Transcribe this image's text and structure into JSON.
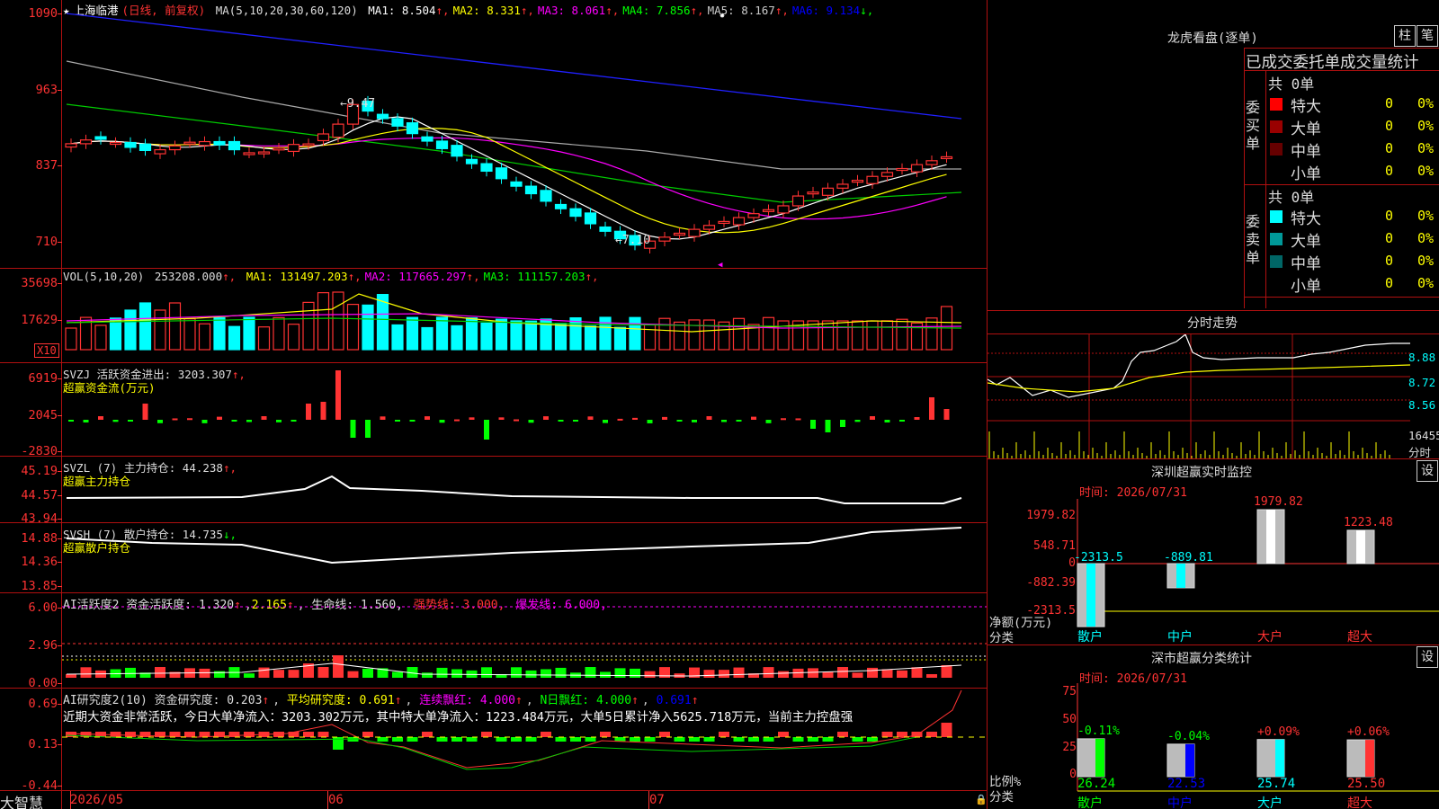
{
  "colors": {
    "up": "#ff3333",
    "down": "#00ffff",
    "green": "#00ff00",
    "grid": "#b01010"
  },
  "price": {
    "stock_name": "上海临港",
    "period_label": "(日线, 前复权)",
    "ma_params": "MA(5,10,20,30,60,120)",
    "ma": [
      {
        "label": "MA1:",
        "value": "8.504",
        "arrow": "↑",
        "color": "#ffffff"
      },
      {
        "label": "MA2:",
        "value": "8.331",
        "arrow": "↑",
        "color": "#ffff00"
      },
      {
        "label": "MA3:",
        "value": "8.061",
        "arrow": "↑",
        "color": "#ff00ff"
      },
      {
        "label": "MA4:",
        "value": "7.856",
        "arrow": "↑",
        "color": "#00ff00"
      },
      {
        "label": "MA5:",
        "value": "8.167",
        "arrow": "↑",
        "color": "#cccccc"
      },
      {
        "label": "MA6:",
        "value": "9.134",
        "arrow": "↓",
        "color": "#0000ff"
      }
    ],
    "y_ticks": [
      "1090",
      "963",
      "837",
      "710"
    ],
    "high_label": "←9.47",
    "low_label": "←7.10"
  },
  "vol": {
    "header": "VOL(5,10,20)",
    "value": "253208.000",
    "ma": [
      {
        "label": "MA1:",
        "value": "131497.203",
        "color": "#ffff00"
      },
      {
        "label": "MA2:",
        "value": "117665.297",
        "color": "#ff00ff"
      },
      {
        "label": "MA3:",
        "value": "111157.203",
        "color": "#00ff00"
      }
    ],
    "y_ticks": [
      "35698",
      "17629"
    ],
    "unit": "X10"
  },
  "svzj": {
    "header": "SVZJ  活跃资金进出:",
    "value": "3203.307",
    "sub": "超赢资金流(万元)",
    "y_ticks": [
      "6919",
      "2045",
      "-2830"
    ]
  },
  "svzl": {
    "header": "SVZL (7) 主力持仓:",
    "value": "44.238",
    "sub": "超赢主力持仓",
    "y_ticks": [
      "45.19",
      "44.57",
      "43.94"
    ]
  },
  "svsh": {
    "header": "SVSH (7) 散户持仓:",
    "value": "14.735",
    "sub": "超赢散户持仓",
    "y_ticks": [
      "14.88",
      "14.36",
      "13.85"
    ]
  },
  "ai1": {
    "header": "AI活跃度2 资金活跃度:",
    "v1": "1.320",
    "v2": "2.165",
    "life_label": "生命线:",
    "life": "1.560,",
    "strong": "强势线: 3.000,",
    "burst": "爆发线: 6.000,",
    "y_ticks": [
      "6.00",
      "2.96",
      "0.00"
    ]
  },
  "ai2": {
    "header": "AI研究度2(10) 资金研究度:",
    "v1": "0.203",
    "avg": "平均研究度: 0.691",
    "cont": "连续飘红: 4.000",
    "nday": "N日飘红: 4.000",
    "last": "0.691",
    "summary": "近期大资金非常活跃，今日大单净流入：3203.302万元，其中特大单净流入：1223.484万元，大单5日累计净入5625.718万元，当前主力控盘强",
    "y_ticks": [
      "0.69",
      "0.13",
      "-0.44"
    ]
  },
  "xaxis": {
    "labels": [
      "2026/05",
      "06",
      "07"
    ]
  },
  "footer": {
    "brand": "大智慧"
  },
  "dragon": {
    "title": "龙虎看盘(逐单)",
    "btn1": "柱",
    "btn2": "笔",
    "subtitle": "已成交委托单成交量统计",
    "buy": {
      "side": "委买单",
      "count": "共 0单",
      "rows": [
        {
          "label": "特大",
          "v": "0",
          "p": "0%",
          "color": "#ff0000"
        },
        {
          "label": "大单",
          "v": "0",
          "p": "0%",
          "color": "#990000"
        },
        {
          "label": "中单",
          "v": "0",
          "p": "0%",
          "color": "#660000"
        },
        {
          "label": "小单",
          "v": "0",
          "p": "0%",
          "color": "#000000"
        }
      ]
    },
    "sell": {
      "side": "委卖单",
      "count": "共 0单",
      "rows": [
        {
          "label": "特大",
          "v": "0",
          "p": "0%",
          "color": "#00ffff"
        },
        {
          "label": "大单",
          "v": "0",
          "p": "0%",
          "color": "#009999"
        },
        {
          "label": "中单",
          "v": "0",
          "p": "0%",
          "color": "#006666"
        },
        {
          "label": "小单",
          "v": "0",
          "p": "0%",
          "color": "#000000"
        }
      ]
    }
  },
  "intraday": {
    "title": "分时走势",
    "y_ticks": [
      "8.88",
      "8.72",
      "8.56"
    ],
    "vol_tick": "16455",
    "vol_unit": "分时"
  },
  "monitor": {
    "title": "深圳超赢实时监控",
    "btn": "设",
    "time": "时间: 2026/07/31",
    "y_ticks": [
      "1979.82",
      "548.71",
      "0",
      "-882.39",
      "-2313.5"
    ],
    "axis_label1": "净额(万元)",
    "axis_label2": "分类",
    "cats": [
      {
        "name": "散户",
        "value": "-2313.5",
        "num": -2313.5
      },
      {
        "name": "中户",
        "value": "-889.81",
        "num": -889.81
      },
      {
        "name": "大户",
        "value": "1979.82",
        "num": 1979.82
      },
      {
        "name": "超大",
        "value": "1223.48",
        "num": 1223.48
      }
    ]
  },
  "classify": {
    "title": "深市超赢分类统计",
    "btn": "设",
    "time": "时间: 2026/07/31",
    "y_ticks": [
      "75",
      "50",
      "25",
      "0"
    ],
    "axis_label1": "比例%",
    "axis_label2": "分类",
    "cats": [
      {
        "name": "散户",
        "change": "-0.11%",
        "value": "26.24",
        "num": 26.24
      },
      {
        "name": "中户",
        "change": "-0.04%",
        "value": "22.53",
        "num": 22.53
      },
      {
        "name": "大户",
        "change": "+0.09%",
        "value": "25.74",
        "num": 25.74
      },
      {
        "name": "超大",
        "change": "+0.06%",
        "value": "25.50",
        "num": 25.5
      }
    ]
  }
}
